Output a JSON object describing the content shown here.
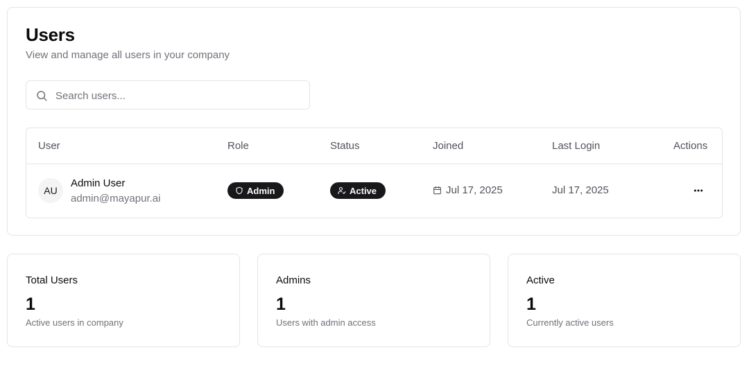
{
  "header": {
    "title": "Users",
    "subtitle": "View and manage all users in your company"
  },
  "search": {
    "placeholder": "Search users...",
    "value": ""
  },
  "table": {
    "columns": {
      "user": "User",
      "role": "Role",
      "status": "Status",
      "joined": "Joined",
      "last_login": "Last Login",
      "actions": "Actions"
    },
    "rows": [
      {
        "initials": "AU",
        "name": "Admin User",
        "email": "admin@mayapur.ai",
        "role": "Admin",
        "status": "Active",
        "joined": "Jul 17, 2025",
        "last_login": "Jul 17, 2025"
      }
    ]
  },
  "stats": [
    {
      "title": "Total Users",
      "value": "1",
      "description": "Active users in company"
    },
    {
      "title": "Admins",
      "value": "1",
      "description": "Users with admin access"
    },
    {
      "title": "Active",
      "value": "1",
      "description": "Currently active users"
    }
  ],
  "icons": {
    "search": "search-icon",
    "role_badge": "shield-icon",
    "status_badge": "user-check-icon",
    "joined": "calendar-icon",
    "actions": "more-horizontal-icon"
  },
  "colors": {
    "badge_bg": "#18181b",
    "muted_text": "#71717a",
    "border": "#e4e4e7"
  }
}
